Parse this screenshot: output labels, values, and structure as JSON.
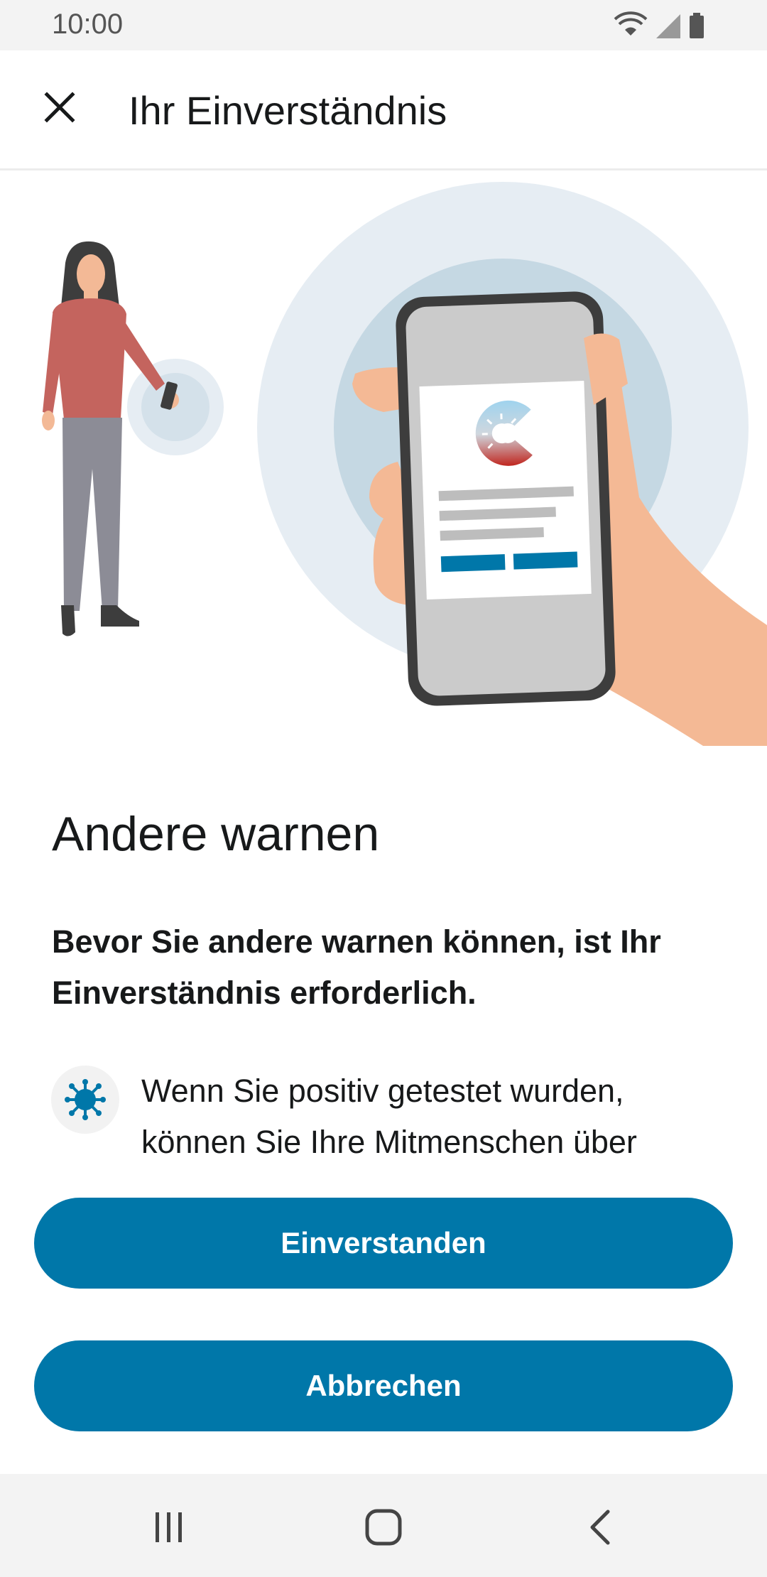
{
  "status_bar": {
    "time": "10:00",
    "icons": [
      "wifi-icon",
      "cell-signal-icon",
      "battery-icon"
    ]
  },
  "app_bar": {
    "title": "Ihr Einverständnis",
    "close_icon": "close-icon"
  },
  "content": {
    "heading": "Andere warnen",
    "subtitle": "Bevor Sie andere warnen können, ist Ihr Einverständnis erforderlich.",
    "info_text": "Wenn Sie positiv getestet wurden, können Sie Ihre Mitmenschen über",
    "info_icon": "virus-icon"
  },
  "buttons": {
    "accept": "Einverstanden",
    "cancel": "Abbrechen"
  },
  "nav_bar": {
    "icons": [
      "recent-apps-icon",
      "home-icon",
      "back-icon"
    ]
  },
  "colors": {
    "accent": "#0077a9",
    "app_logo_red": "#c0261f",
    "illustration_circle": "#e6edf3"
  }
}
